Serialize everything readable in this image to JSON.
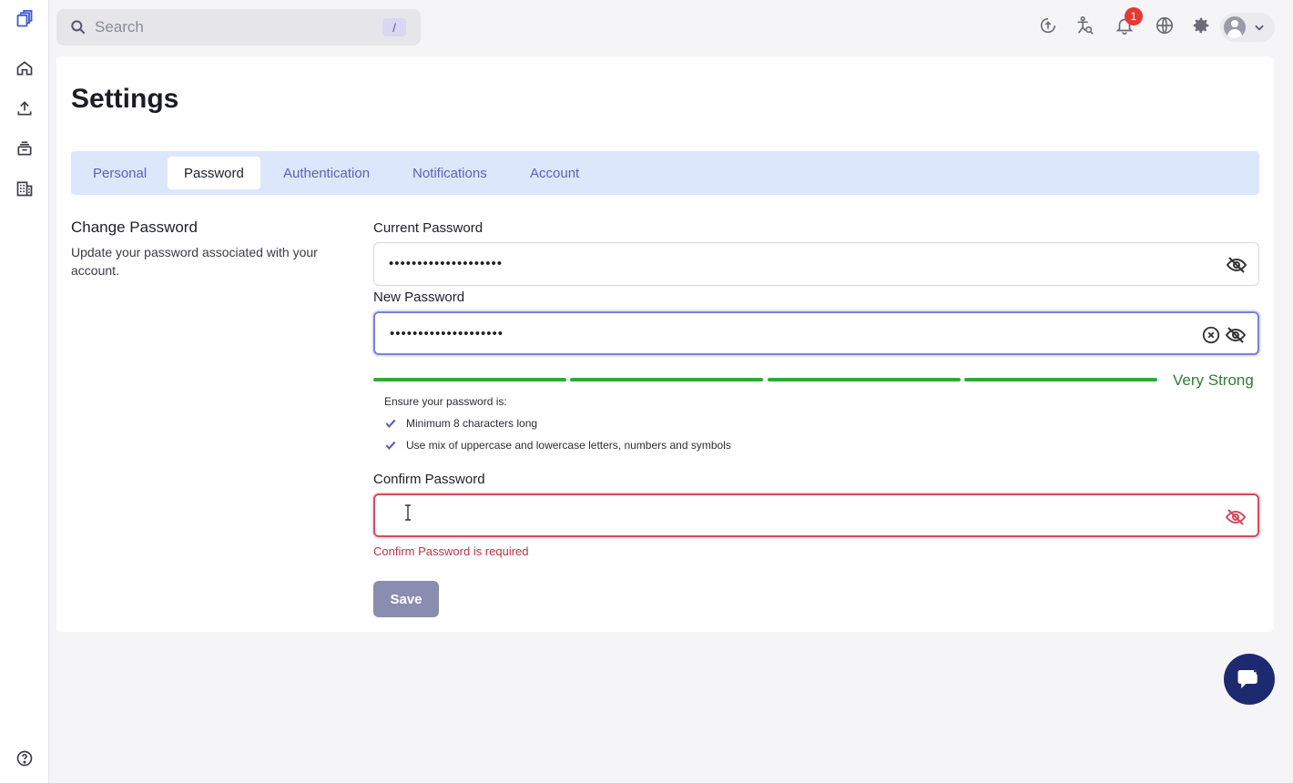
{
  "sidebar": {
    "items": [
      {
        "name": "logo",
        "icon": "app-logo-icon"
      },
      {
        "name": "home",
        "icon": "home-icon"
      },
      {
        "name": "upload",
        "icon": "upload-icon"
      },
      {
        "name": "archive",
        "icon": "archive-icon"
      },
      {
        "name": "organizations",
        "icon": "building-icon"
      },
      {
        "name": "help",
        "icon": "help-icon"
      }
    ]
  },
  "topbar": {
    "search_placeholder": "Search",
    "search_shortcut": "/",
    "notifications_count": "1",
    "icons": [
      "upload-circle-icon",
      "translate-icon",
      "bell-icon",
      "globe-icon",
      "gear-icon",
      "user-avatar-icon",
      "chevron-down-icon"
    ]
  },
  "page": {
    "title": "Settings",
    "tabs": [
      {
        "label": "Personal",
        "active": false
      },
      {
        "label": "Password",
        "active": true
      },
      {
        "label": "Authentication",
        "active": false
      },
      {
        "label": "Notifications",
        "active": false
      },
      {
        "label": "Account",
        "active": false
      }
    ]
  },
  "section": {
    "title": "Change Password",
    "description": "Update your password associated with your account."
  },
  "form": {
    "current_password": {
      "label": "Current Password",
      "value": "••••••••••••••••••••"
    },
    "new_password": {
      "label": "New Password",
      "value": "••••••••••••••••••••"
    },
    "strength": {
      "label": "Very Strong",
      "level": 4,
      "max": 4,
      "color": "#2eaa3c"
    },
    "requirements": {
      "title": "Ensure your password is:",
      "items": [
        "Minimum 8 characters long",
        "Use mix of uppercase and lowercase letters, numbers and symbols"
      ]
    },
    "confirm_password": {
      "label": "Confirm Password",
      "value": "",
      "error": "Confirm Password is required"
    },
    "save_label": "Save"
  },
  "colors": {
    "accent": "#5a64b8",
    "tab_bar": "#dde7fb",
    "error": "#d8485e",
    "success": "#2eaa3c",
    "chat_button": "#1e2a70"
  }
}
